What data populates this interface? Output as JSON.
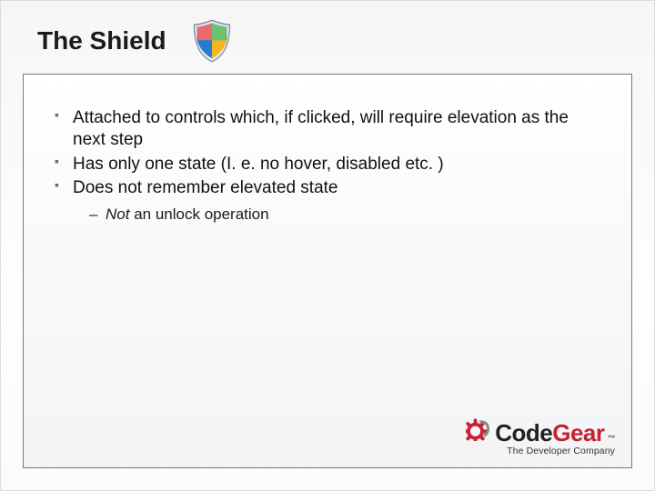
{
  "title": "The Shield",
  "bullets": [
    "Attached to controls which, if clicked, will require elevation as the next step",
    "Has only one state (I. e. no hover, disabled etc. )",
    "Does not remember elevated state"
  ],
  "sub_bullet_prefix": "Not",
  "sub_bullet_rest": " an unlock operation",
  "logo": {
    "part1": "Code",
    "part2": "Gear",
    "tm": "™",
    "tagline": "The Developer Company"
  }
}
